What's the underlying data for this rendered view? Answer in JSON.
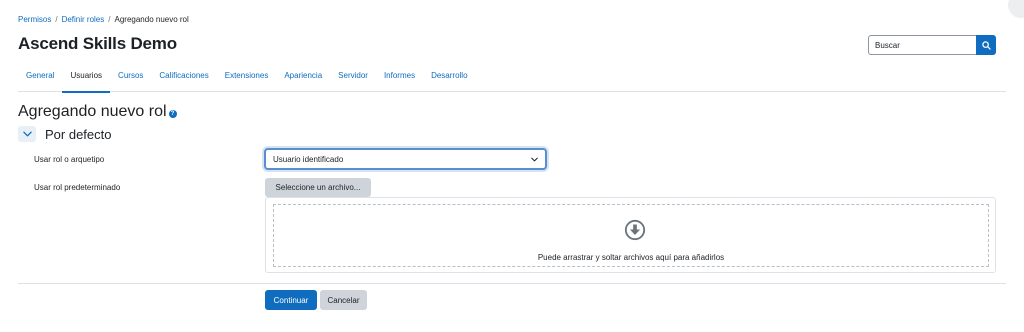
{
  "breadcrumb": {
    "items": [
      "Permisos",
      "Definir roles"
    ],
    "current": "Agregando nuevo rol",
    "separator": "/"
  },
  "site": {
    "title": "Ascend Skills Demo"
  },
  "search": {
    "placeholder": "Buscar",
    "icon": "search-icon"
  },
  "tabs": [
    {
      "label": "General",
      "active": false
    },
    {
      "label": "Usuarios",
      "active": true
    },
    {
      "label": "Cursos",
      "active": false
    },
    {
      "label": "Calificaciones",
      "active": false
    },
    {
      "label": "Extensiones",
      "active": false
    },
    {
      "label": "Apariencia",
      "active": false
    },
    {
      "label": "Servidor",
      "active": false
    },
    {
      "label": "Informes",
      "active": false
    },
    {
      "label": "Desarrollo",
      "active": false
    }
  ],
  "page": {
    "heading": "Agregando nuevo rol",
    "help_icon": "question-circle-icon"
  },
  "section": {
    "title": "Por defecto",
    "toggle_icon": "chevron-down-icon"
  },
  "form": {
    "archetype_label": "Usar rol o arquetipo",
    "archetype_value": "Usuario identificado",
    "preset_label": "Usar rol predeterminado",
    "file_button": "Seleccione un archivo...",
    "dropzone_text": "Puede arrastrar y soltar archivos aquí para añadirlos",
    "dropzone_icon": "download-circle-icon"
  },
  "actions": {
    "submit": "Continuar",
    "cancel": "Cancelar"
  },
  "colors": {
    "accent": "#0f6cbf",
    "text": "#1d2125",
    "secondary_button": "#ced4da",
    "border": "#dee2e6"
  }
}
